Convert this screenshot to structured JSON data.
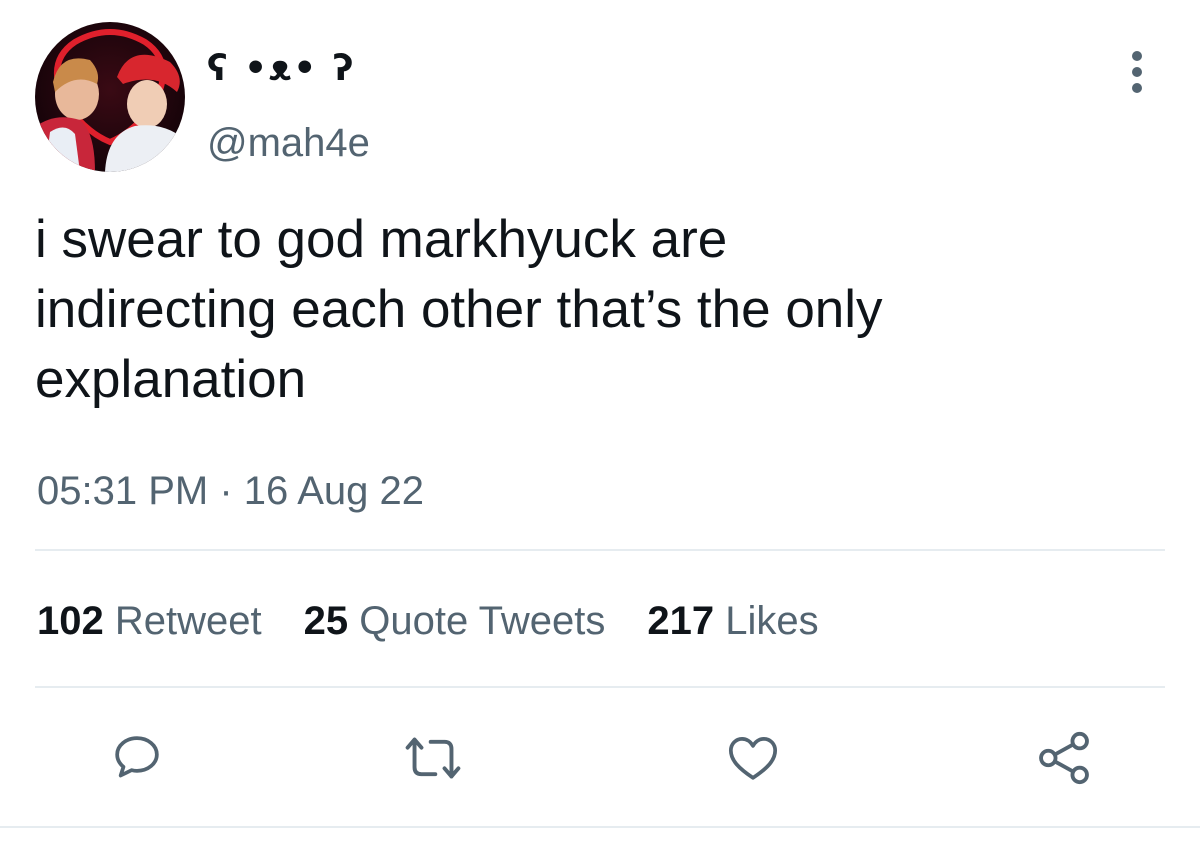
{
  "author": {
    "display_name": "ʕ •ᴥ• ʔ",
    "handle": "@mah4e"
  },
  "tweet": {
    "text_lines": [
      "i swear to god markhyuck are",
      "indirecting each other that’s the only",
      "explanation"
    ],
    "time": "05:31 PM",
    "separator": "·",
    "date": "16 Aug 22"
  },
  "stats": {
    "retweets": {
      "count": "102",
      "label": "Retweet"
    },
    "quotes": {
      "count": "25",
      "label": "Quote Tweets"
    },
    "likes": {
      "count": "217",
      "label": "Likes"
    }
  },
  "icons": {
    "more": "more-vertical-icon",
    "reply": "reply-icon",
    "retweet": "retweet-icon",
    "like": "heart-icon",
    "share": "share-icon"
  },
  "colors": {
    "text_primary": "#0f1419",
    "text_secondary": "#536471",
    "divider": "#e6ecf0",
    "icon": "#536471",
    "avatar_accent": "#d81e2a"
  }
}
